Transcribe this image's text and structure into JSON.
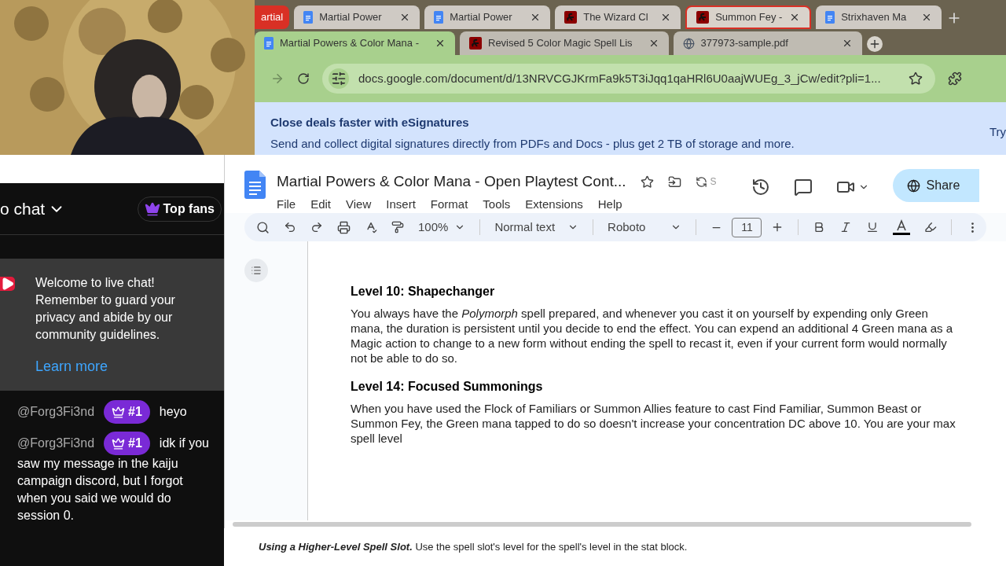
{
  "back_tabs": [
    {
      "label": "artial",
      "kind": "group",
      "selected": false
    },
    {
      "label": "Martial Power",
      "kind": "docs",
      "selected": false
    },
    {
      "label": "Martial Power",
      "kind": "docs",
      "selected": false
    },
    {
      "label": "The Wizard Cl",
      "kind": "dnd",
      "selected": false
    },
    {
      "label": "Summon Fey -",
      "kind": "dnd",
      "selected": true
    },
    {
      "label": "Strixhaven Ma",
      "kind": "docs",
      "selected": false
    }
  ],
  "front_tabs": [
    {
      "label": "Martial Powers & Color Mana -",
      "kind": "docs",
      "selected": true
    },
    {
      "label": "Revised 5 Color Magic Spell Lis",
      "kind": "dnd",
      "selected": false
    },
    {
      "label": "377973-sample.pdf",
      "kind": "web",
      "selected": false
    }
  ],
  "address": "docs.google.com/document/d/13NRVCGJKrmFa9k5T3iJqq1qaHRl6U0aajWUEg_3_jCw/edit?pli=1...",
  "banner": {
    "title": "Close deals faster with eSignatures",
    "text": "Send and collect digital signatures directly from PDFs and Docs - plus get 2 TB of storage and more.",
    "action": "Try"
  },
  "chat": {
    "title": "o chat",
    "top_fans": "Top fans",
    "welcome": "Welcome to live chat! Remember to guard your privacy and abide by our community guidelines.",
    "learn_more": "Learn more",
    "messages": [
      {
        "author": "@Forg3Fi3nd",
        "badge": "#1",
        "text": "heyo"
      },
      {
        "author": "@Forg3Fi3nd",
        "badge": "#1",
        "text": "idk if you",
        "continuation": "saw my message in the kaiju campaign discord, but I forgot when you said we would do session 0."
      }
    ]
  },
  "docs": {
    "title": "Martial Powers & Color Mana - Open Playtest Cont...",
    "status": "S",
    "menu": [
      "File",
      "Edit",
      "View",
      "Insert",
      "Format",
      "Tools",
      "Extensions",
      "Help"
    ],
    "share": "Share",
    "zoom": "100%",
    "style": "Normal text",
    "font": "Roboto",
    "font_size": "11",
    "sections": [
      {
        "heading": "Level 10: Shapechanger",
        "text": "You always have the *Polymorph* spell prepared, and whenever you cast it on yourself by expending only Green mana, the duration is persistent until you decide to end the effect. You can expend an additional 4 Green mana as a Magic action to change to a new form without ending the spell to recast it, even if your current form would normally not be able to do so."
      },
      {
        "heading": "Level 14: Focused Summonings",
        "text": "When you have used the Flock of Familiars or Summon Allies feature to cast Find Familiar, Summon Beast or Summon Fey, the Green mana tapped to do so doesn't increase your concentration DC above 10. You are your max spell level"
      }
    ]
  },
  "behind_text": "**Using a Higher-Level Spell Slot.** Use the spell slot's level for the spell's level in the stat block."
}
